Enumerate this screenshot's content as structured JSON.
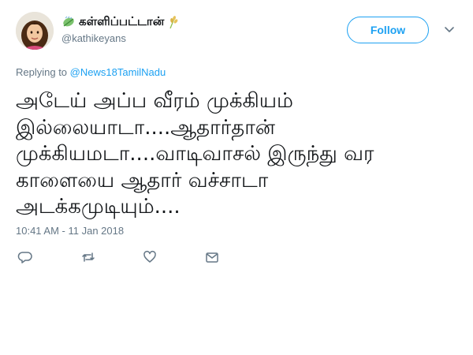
{
  "tweet": {
    "display_name": "கள்ளிப்பட்டான்",
    "handle": "@kathikeyans",
    "follow_label": "Follow",
    "reply_prefix": "Replying to",
    "reply_to": "@News18TamilNadu",
    "text_lines": [
      "அடேய் அப்ப வீரம் முக்கியம்",
      "இல்லையாடா....ஆதார்தான்",
      "முக்கியமடா....வாடிவாசல் இருந்து வர",
      "காளையை ஆதார் வச்சாடா",
      "அடக்கமுடியும்...."
    ],
    "timestamp": "10:41 AM - 11 Jan 2018"
  },
  "colors": {
    "accent": "#1da1f2",
    "muted": "#657786",
    "text": "#14171a"
  },
  "icons": {
    "name_prefix": "leaf-icon",
    "name_suffix": "wheat-icon",
    "menu": "chevron-down-icon",
    "actions": [
      "reply-icon",
      "retweet-icon",
      "like-icon",
      "message-icon"
    ]
  }
}
